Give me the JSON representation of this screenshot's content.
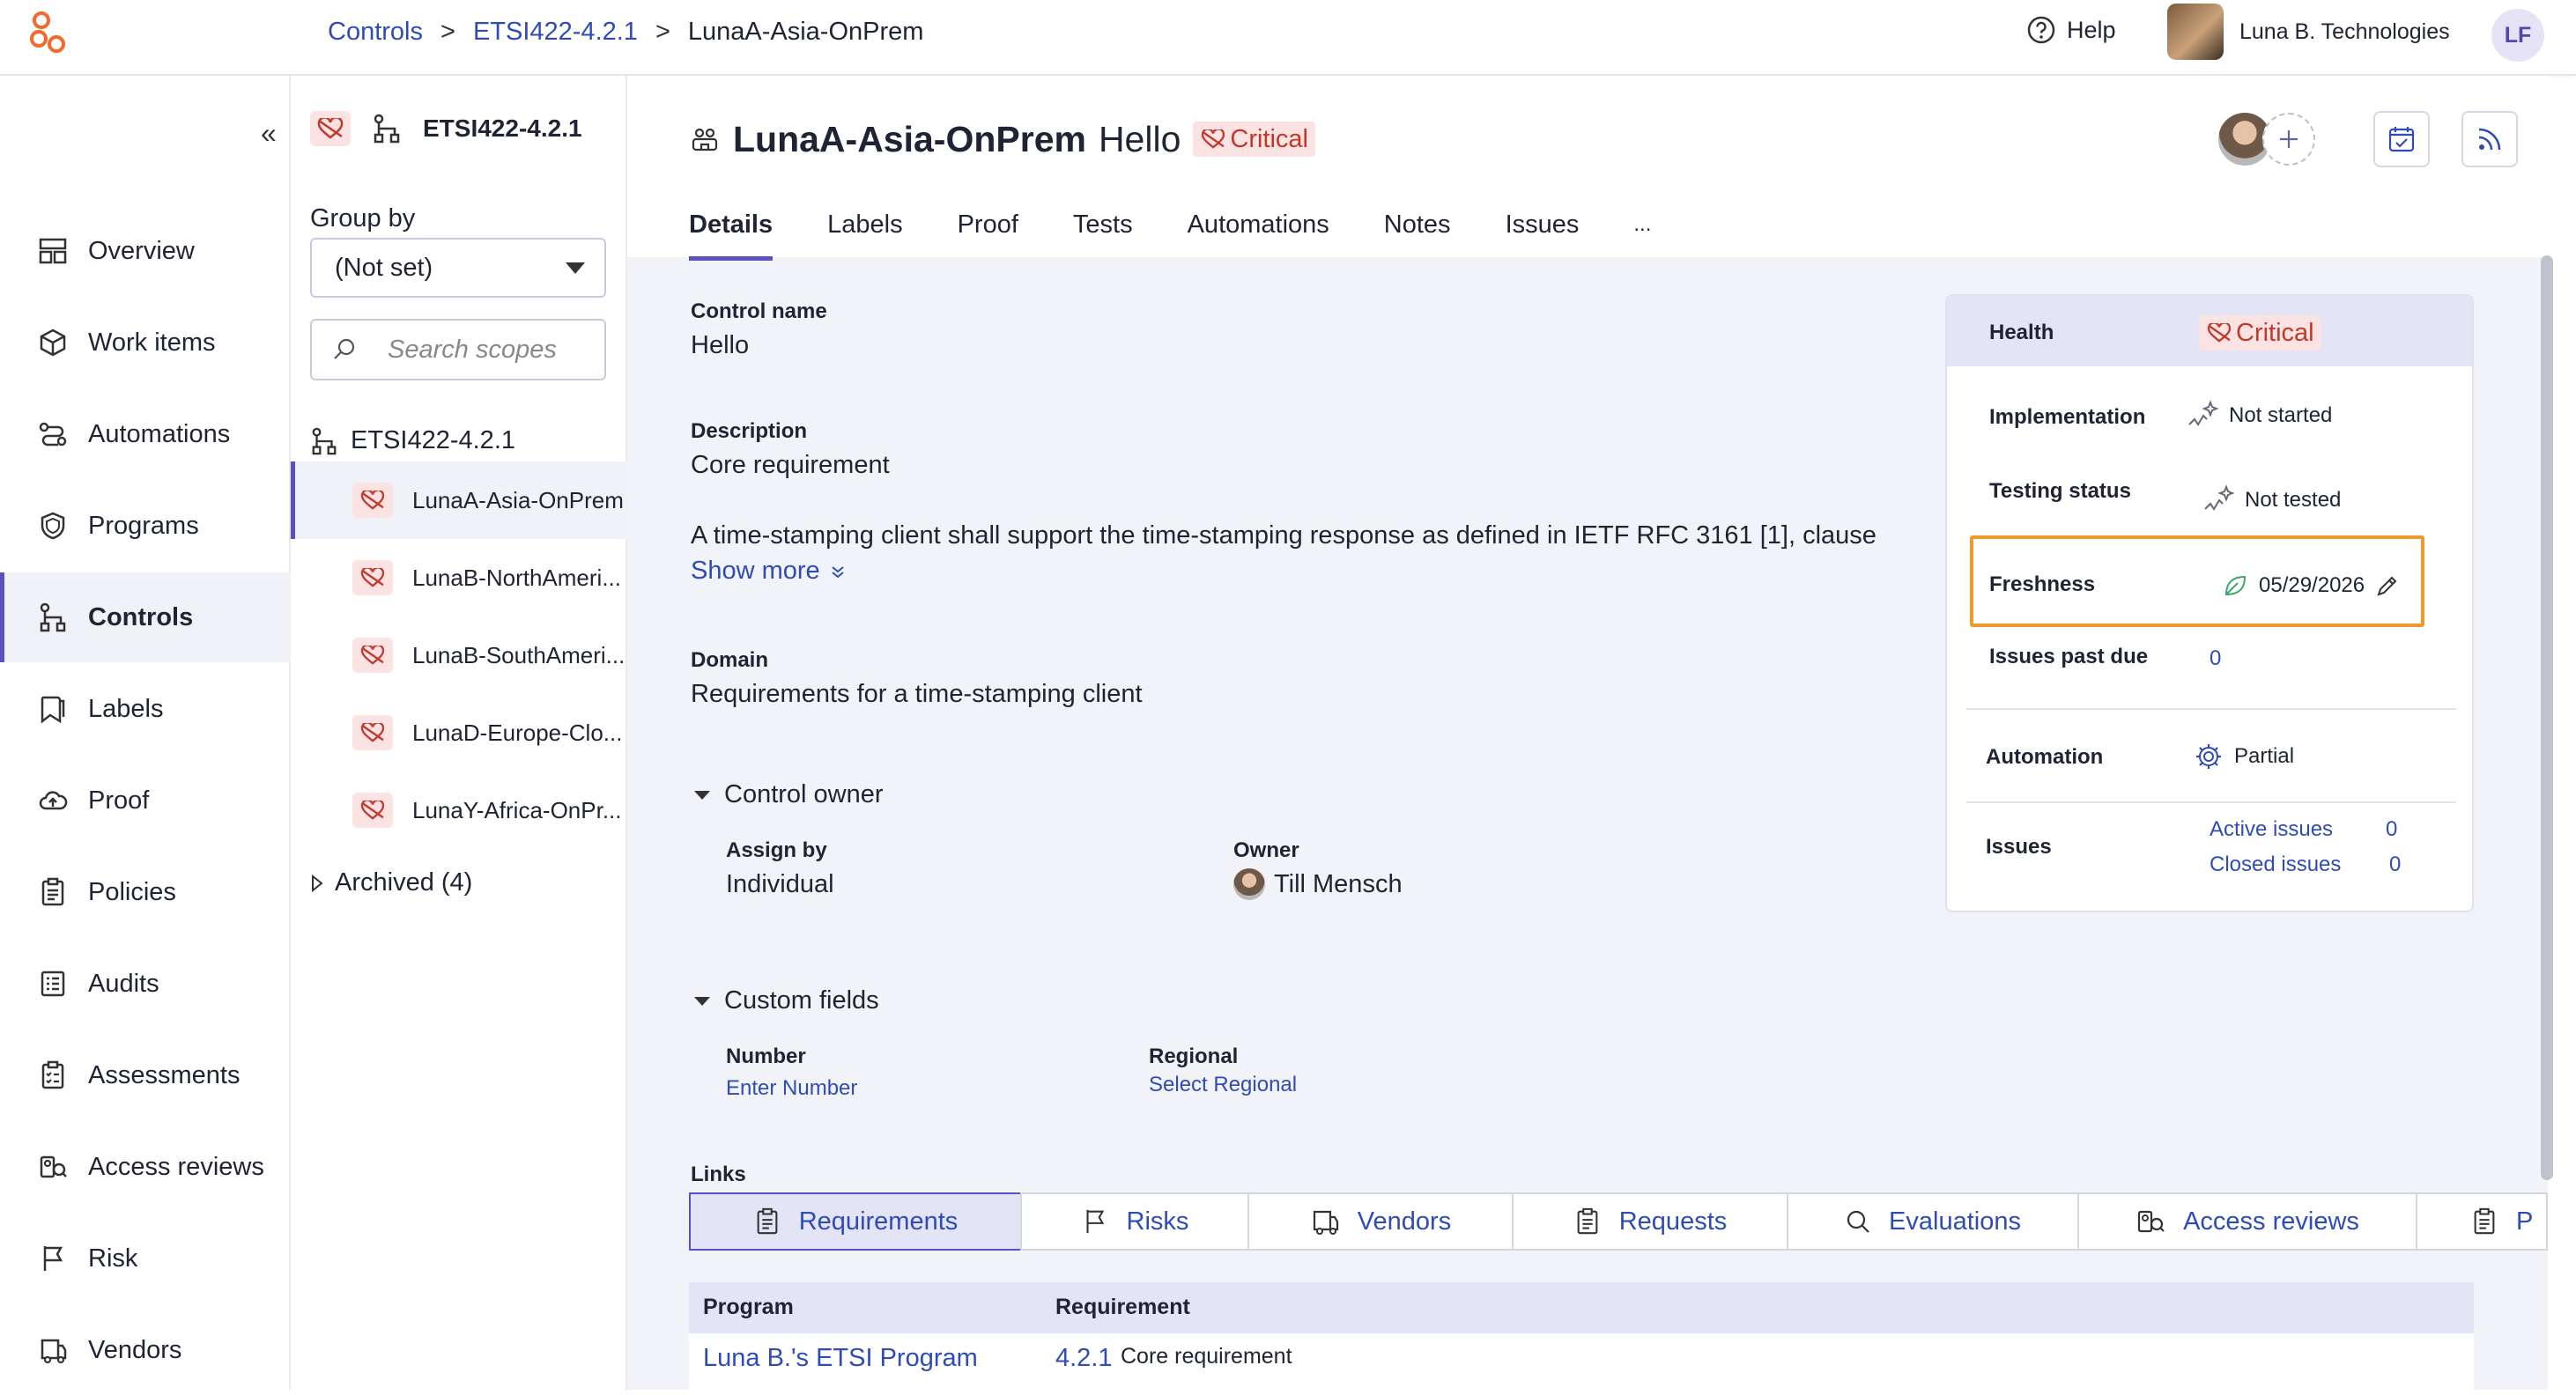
{
  "breadcrumbs": [
    "Controls",
    "ETSI422-4.2.1",
    "LunaA-Asia-OnPrem"
  ],
  "breadcrumb_separator": ">",
  "header": {
    "help": "Help",
    "org": "Luna B. Technologies",
    "user_initials": "LF"
  },
  "nav": {
    "collapse": "«",
    "items": [
      {
        "label": "Overview",
        "icon": "overview-icon"
      },
      {
        "label": "Work items",
        "icon": "cube-icon"
      },
      {
        "label": "Automations",
        "icon": "automation-icon"
      },
      {
        "label": "Programs",
        "icon": "shield-icon"
      },
      {
        "label": "Controls",
        "icon": "controls-icon",
        "active": true
      },
      {
        "label": "Labels",
        "icon": "label-icon"
      },
      {
        "label": "Proof",
        "icon": "cloud-icon"
      },
      {
        "label": "Policies",
        "icon": "clipboard-icon"
      },
      {
        "label": "Audits",
        "icon": "list-icon"
      },
      {
        "label": "Assessments",
        "icon": "checklist-icon"
      },
      {
        "label": "Access reviews",
        "icon": "access-review-icon"
      },
      {
        "label": "Risk",
        "icon": "flag-icon"
      },
      {
        "label": "Vendors",
        "icon": "vendor-icon"
      }
    ]
  },
  "scope": {
    "title": "ETSI422-4.2.1",
    "group_by_label": "Group by",
    "group_by_value": "(Not set)",
    "search_placeholder": "Search scopes",
    "root": "ETSI422-4.2.1",
    "items": [
      "LunaA-Asia-OnPrem",
      "LunaB-NorthAmeri...",
      "LunaB-SouthAmeri...",
      "LunaD-Europe-Clo...",
      "LunaY-Africa-OnPr..."
    ],
    "archived": "Archived (4)"
  },
  "control": {
    "scope_name": "LunaA-Asia-OnPrem",
    "name": "Hello",
    "health_badge": "Critical",
    "tabs": [
      "Details",
      "Labels",
      "Proof",
      "Tests",
      "Automations",
      "Notes",
      "Issues",
      "..."
    ],
    "details": {
      "name_label": "Control name",
      "name_value": "Hello",
      "desc_label": "Description",
      "desc_value": "Core requirement",
      "desc_text": "A time-stamping client shall support the time-stamping response as defined in IETF RFC 3161 [1], clause",
      "show_more": "Show more",
      "domain_label": "Domain",
      "domain_value": "Requirements for a time-stamping client",
      "owner_section": "Control owner",
      "assign_by_label": "Assign by",
      "assign_by_value": "Individual",
      "owner_label": "Owner",
      "owner_value": "Till Mensch",
      "custom_section": "Custom fields",
      "number_label": "Number",
      "number_value": "Enter Number",
      "regional_label": "Regional",
      "regional_value": "Select Regional",
      "links_label": "Links"
    }
  },
  "health_card": {
    "health_label": "Health",
    "health_value": "Critical",
    "impl_label": "Implementation",
    "impl_value": "Not started",
    "test_label": "Testing status",
    "test_value": "Not tested",
    "fresh_label": "Freshness",
    "fresh_value": "05/29/2026",
    "past_due_label": "Issues past due",
    "past_due_value": "0",
    "auto_label": "Automation",
    "auto_value": "Partial",
    "issues_label": "Issues",
    "active_label": "Active issues",
    "active_count": "0",
    "closed_label": "Closed issues",
    "closed_count": "0"
  },
  "link_tabs": [
    {
      "label": "Requirements",
      "icon": "clipboard-icon",
      "active": true
    },
    {
      "label": "Risks",
      "icon": "flag-icon"
    },
    {
      "label": "Vendors",
      "icon": "vendor-icon"
    },
    {
      "label": "Requests",
      "icon": "clipboard-icon"
    },
    {
      "label": "Evaluations",
      "icon": "search-icon"
    },
    {
      "label": "Access reviews",
      "icon": "access-review-icon"
    },
    {
      "label": "P",
      "icon": "clipboard-icon"
    }
  ],
  "links_table": {
    "headers": [
      "Program",
      "Requirement"
    ],
    "rows": [
      {
        "program": "Luna B.'s ETSI Program",
        "req_id": "4.2.1",
        "req_text": "Core requirement"
      }
    ]
  },
  "colors": {
    "accent": "#5b4fc4",
    "link": "#2f4bb8",
    "critical": "#c0392b",
    "critical_bg": "#fbe3e3",
    "highlight": "#f09a2e",
    "brand": "#f26a2e"
  }
}
